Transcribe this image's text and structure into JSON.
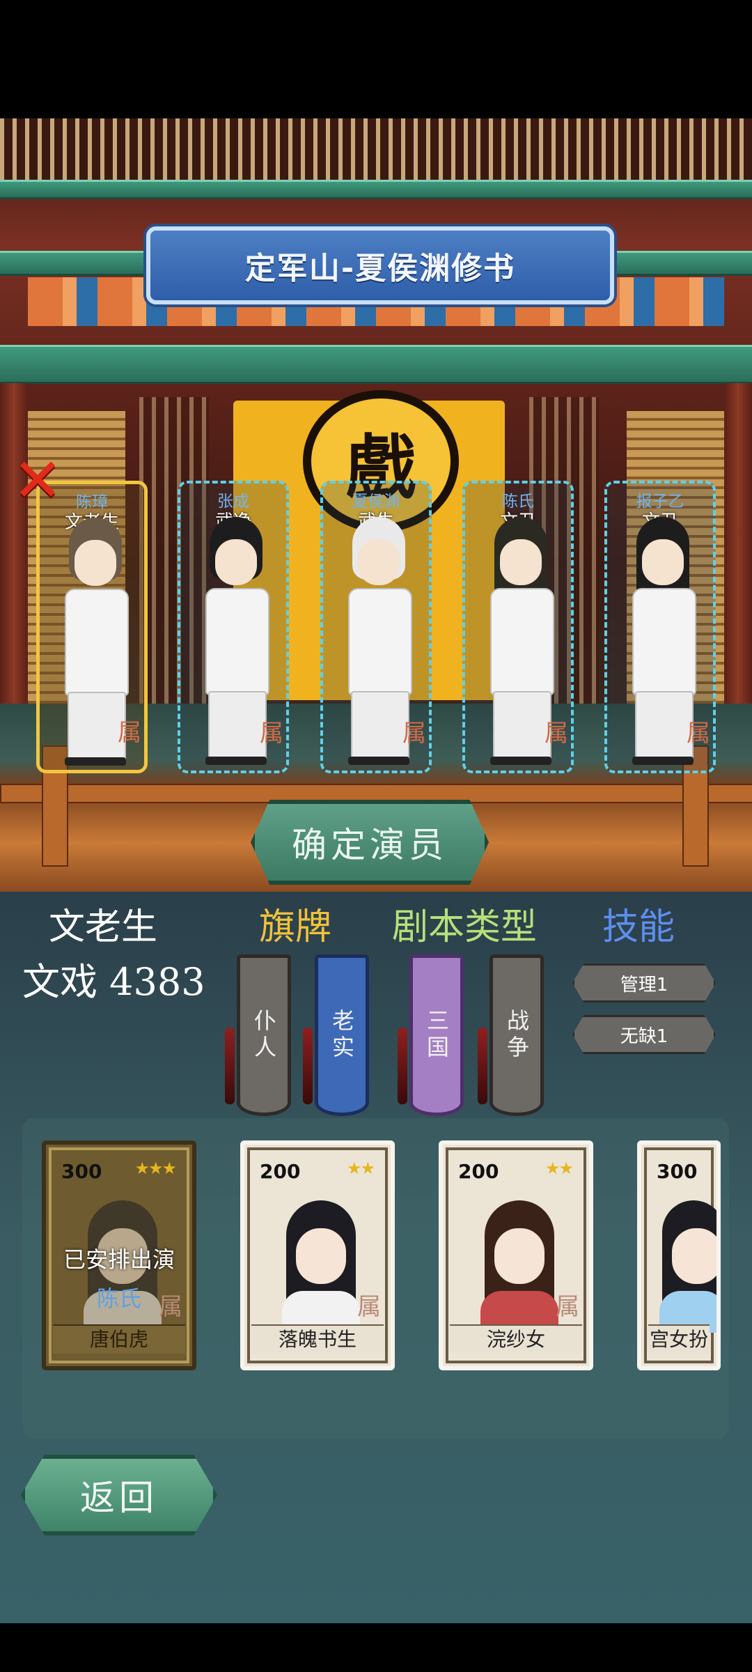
{
  "stage": {
    "title": "定军山-夏侯渊修书",
    "sign_char": "戲",
    "close_icon": "close-x-icon",
    "confirm_label": "确定演员"
  },
  "actors": [
    {
      "name": "陈璋",
      "role": "文老生",
      "attr": "属",
      "selected": true
    },
    {
      "name": "张成",
      "role": "武净",
      "attr": "属",
      "selected": false
    },
    {
      "name": "夏侯渊",
      "role": "武生",
      "attr": "属",
      "selected": false
    },
    {
      "name": "陈氏",
      "role": "文丑",
      "attr": "属",
      "selected": false
    },
    {
      "name": "报子乙",
      "role": "文丑",
      "attr": "属",
      "selected": false
    }
  ],
  "info": {
    "actor_role": "文老生",
    "score_label": "文戏 4383",
    "headers": {
      "banner": "旗牌",
      "script_type": "剧本类型",
      "skill": "技能"
    },
    "header_colors": {
      "banner": "#f2c23a",
      "script_type": "#b7e07a",
      "skill": "#5f8ef0"
    },
    "banner_tags": [
      {
        "label": "仆人",
        "color": "gray"
      },
      {
        "label": "老实",
        "color": "blue"
      }
    ],
    "script_tags": [
      {
        "label": "三国",
        "color": "purple"
      },
      {
        "label": "战争",
        "color": "gray"
      }
    ],
    "skills": [
      "管理1",
      "无缺1"
    ]
  },
  "cards": [
    {
      "cost": "300",
      "stars": "★★★",
      "name": "唐伯虎",
      "status": "已安排出演",
      "assigned_to": "陈氏",
      "attr": "属"
    },
    {
      "cost": "200",
      "stars": "★★",
      "name": "落魄书生",
      "attr": "属"
    },
    {
      "cost": "200",
      "stars": "★★",
      "name": "浣纱女",
      "attr": "属"
    },
    {
      "cost": "300",
      "stars": "",
      "name": "宫女扮"
    }
  ],
  "back_label": "返回"
}
